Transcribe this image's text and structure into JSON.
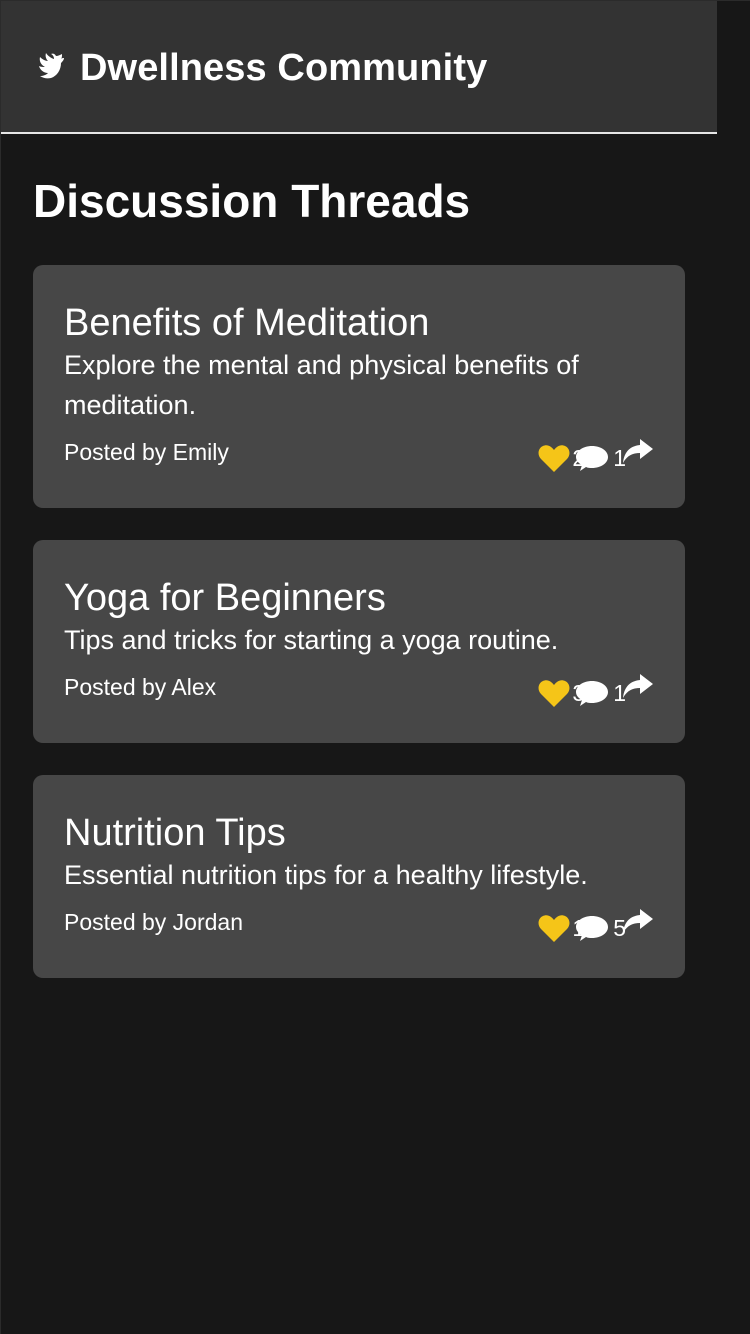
{
  "app": {
    "title": "Dwellness Community",
    "icon": "dove-icon"
  },
  "page": {
    "title": "Discussion Threads"
  },
  "colors": {
    "background": "#171717",
    "header": "#333333",
    "card": "#474747",
    "like": "#f5c518",
    "text": "#ffffff"
  },
  "threads": [
    {
      "title": "Benefits of Meditation",
      "description": "Explore the mental and physical benefits of meditation.",
      "author": "Posted by Emily",
      "likes": "2",
      "comments": "1"
    },
    {
      "title": "Yoga for Beginners",
      "description": "Tips and tricks for starting a yoga routine.",
      "author": "Posted by Alex",
      "likes": "3",
      "comments": "1"
    },
    {
      "title": "Nutrition Tips",
      "description": "Essential nutrition tips for a healthy lifestyle.",
      "author": "Posted by Jordan",
      "likes": "1",
      "comments": "5"
    }
  ]
}
